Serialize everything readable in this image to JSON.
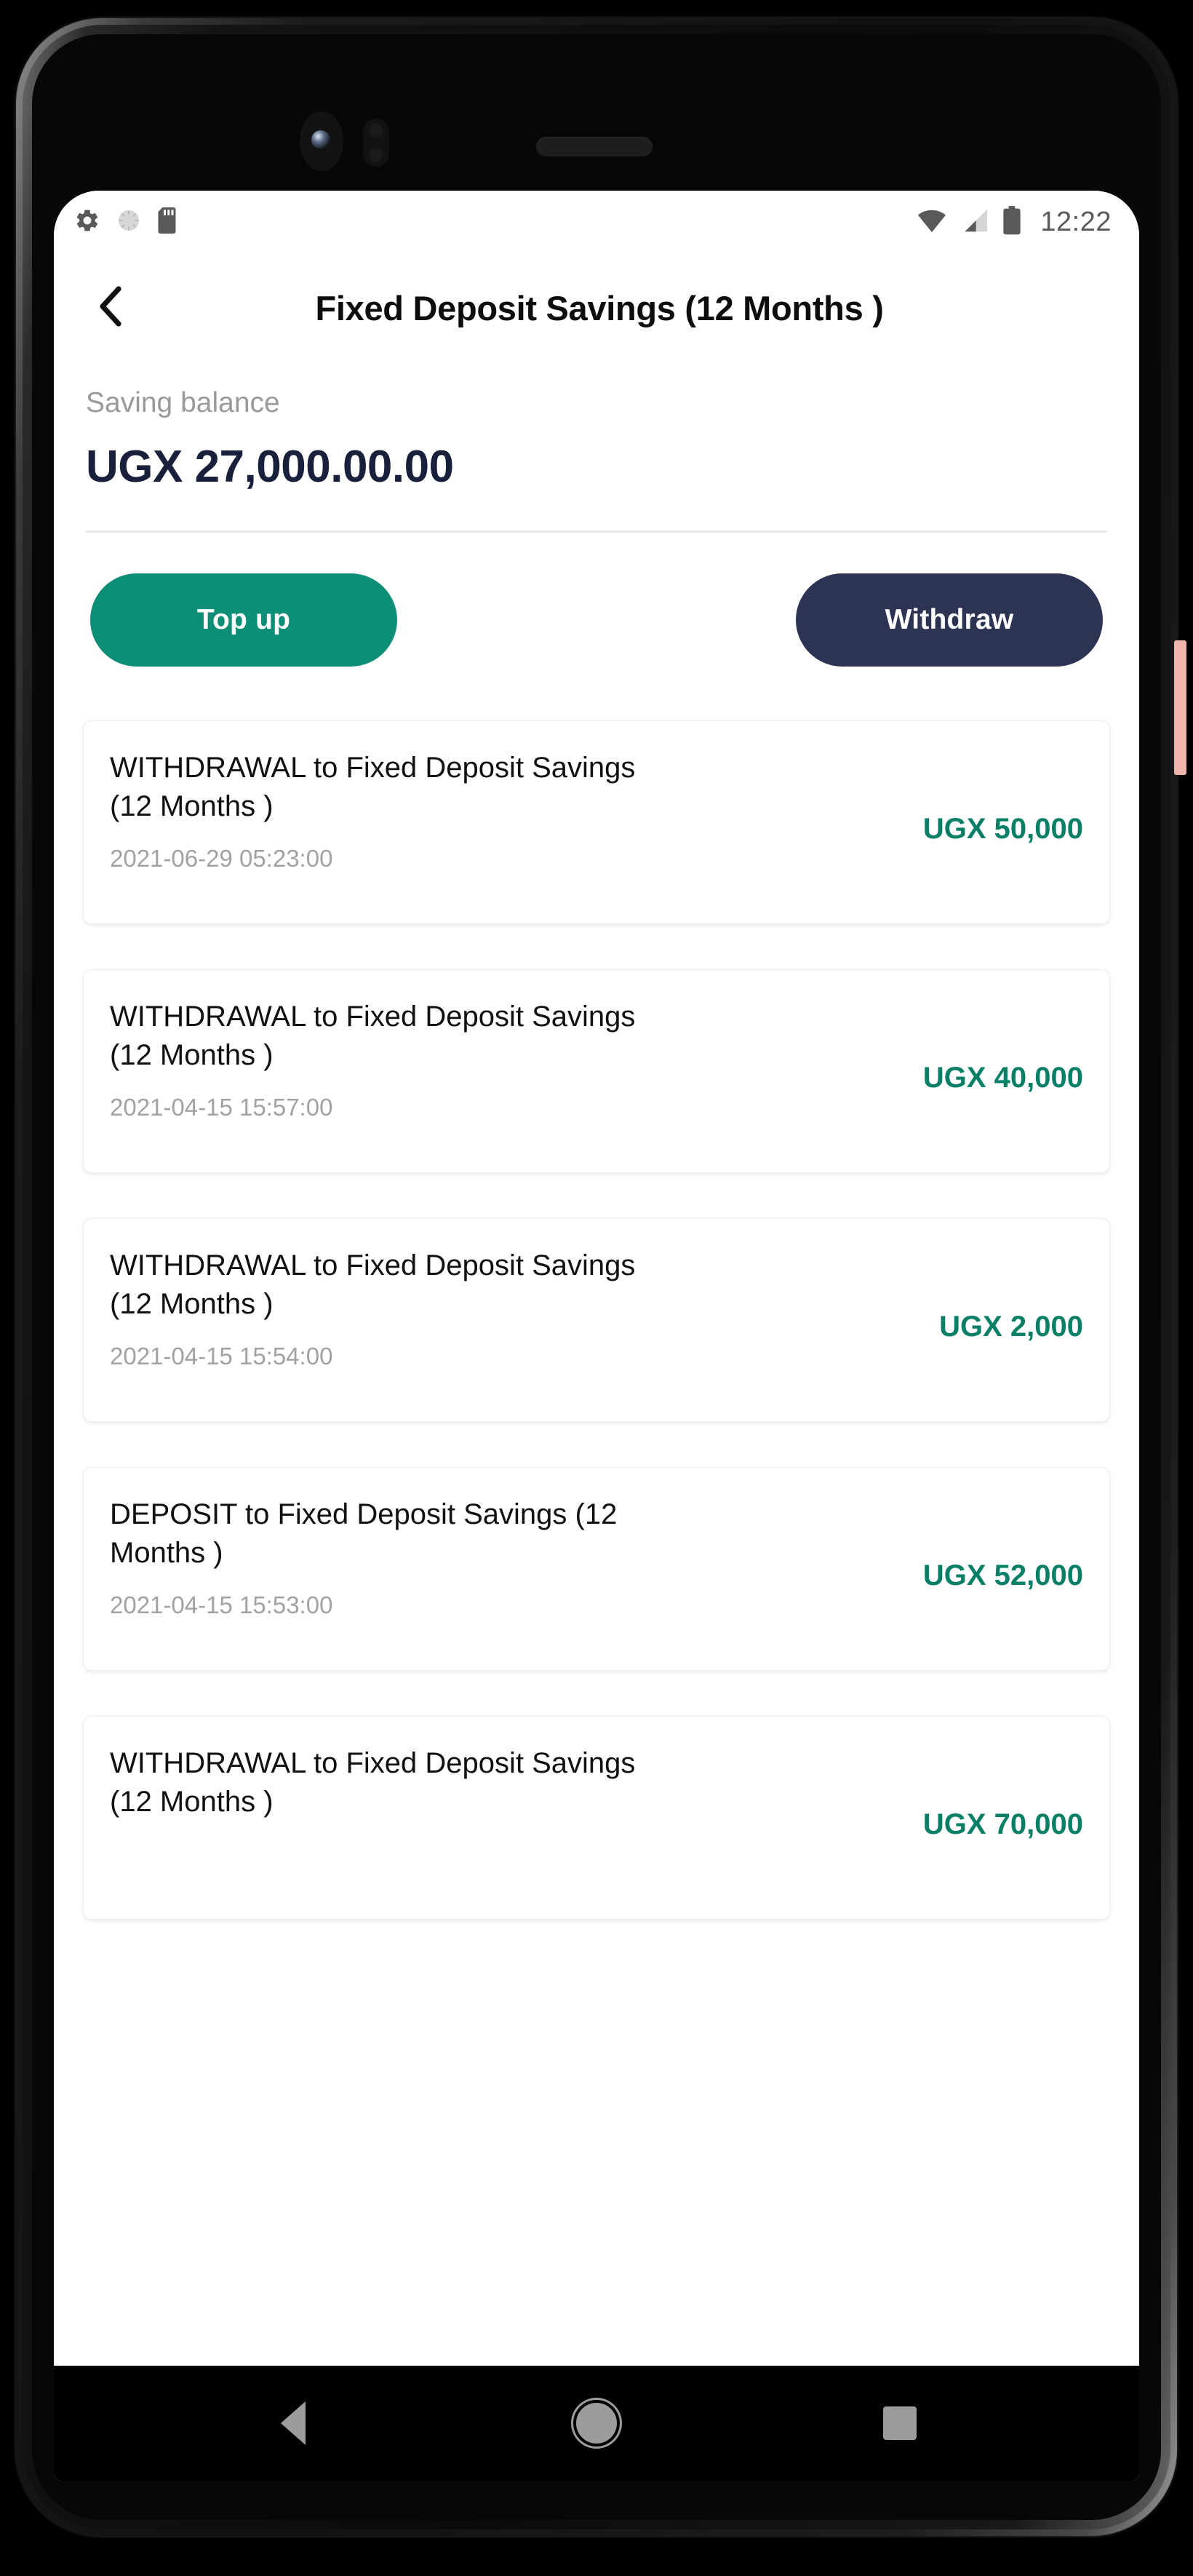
{
  "status_bar": {
    "time": "12:22",
    "left_icons": [
      "gear-icon",
      "sync-spinner-icon",
      "sd-card-icon"
    ],
    "right_icons": [
      "wifi-icon",
      "cellular-signal-icon",
      "battery-icon"
    ]
  },
  "app_bar": {
    "back_icon": "chevron-left-icon",
    "title": "Fixed Deposit Savings (12 Months )"
  },
  "balance": {
    "label": "Saving balance",
    "amount": "UGX 27,000.00.00"
  },
  "actions": {
    "top_up_label": "Top up",
    "withdraw_label": "Withdraw"
  },
  "transactions": [
    {
      "title": "WITHDRAWAL to Fixed Deposit Savings (12 Months )",
      "date": "2021-06-29 05:23:00",
      "amount": "UGX 50,000"
    },
    {
      "title": "WITHDRAWAL to Fixed Deposit Savings (12 Months )",
      "date": "2021-04-15 15:57:00",
      "amount": "UGX 40,000"
    },
    {
      "title": "WITHDRAWAL to Fixed Deposit Savings (12 Months )",
      "date": "2021-04-15 15:54:00",
      "amount": "UGX 2,000"
    },
    {
      "title": "DEPOSIT to Fixed Deposit Savings (12 Months )",
      "date": "2021-04-15 15:53:00",
      "amount": "UGX 52,000"
    },
    {
      "title": "WITHDRAWAL to Fixed Deposit Savings (12 Months )",
      "date": "",
      "amount": "UGX 70,000"
    }
  ],
  "nav_bar": {
    "back_label": "back-triangle-icon",
    "home_label": "home-circle-icon",
    "recents_label": "recents-square-icon"
  },
  "colors": {
    "accent_green": "#0d8f77",
    "amount_green": "#0a7f68",
    "navy": "#2d3453",
    "balance_navy": "#18203b",
    "muted_gray": "#9a9a9a",
    "side_button_pink": "#f0b5ac"
  }
}
